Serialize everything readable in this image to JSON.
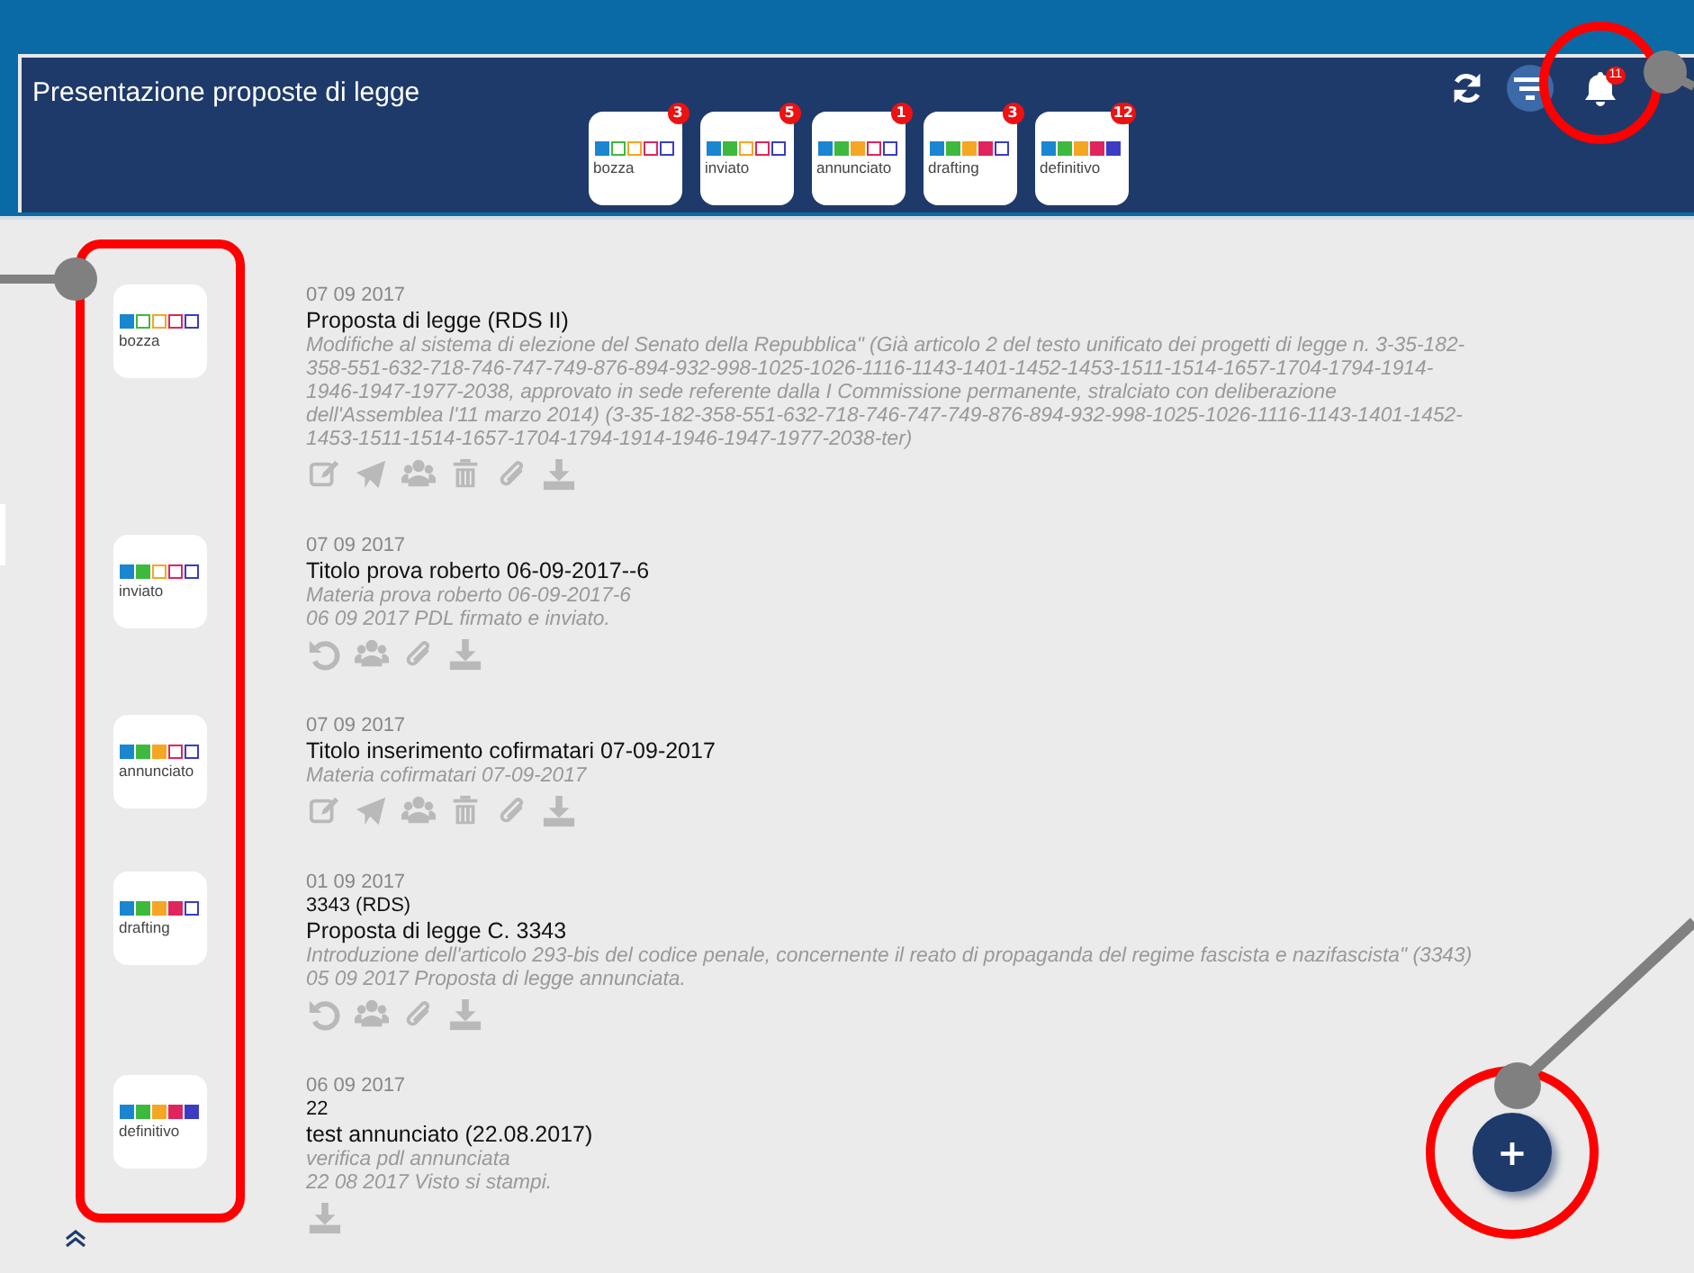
{
  "header": {
    "title": "Presentazione proposte di legge",
    "notifications": {
      "badge": "11",
      "highlighted": true
    }
  },
  "status_tiles": [
    {
      "kind": "bozza",
      "label": "bozza",
      "badge": "3"
    },
    {
      "kind": "inviato",
      "label": "inviato",
      "badge": "5"
    },
    {
      "kind": "annunciato",
      "label": "annunciato",
      "badge": "1"
    },
    {
      "kind": "drafting",
      "label": "drafting",
      "badge": "3"
    },
    {
      "kind": "definitivo",
      "label": "definitivo",
      "badge": "12"
    }
  ],
  "status_column_highlighted": true,
  "proposals": [
    {
      "status": {
        "kind": "bozza",
        "label": "bozza"
      },
      "date": "07 09 2017",
      "title": "Proposta di legge (RDS II)",
      "notes": [
        "Modifiche al sistema di elezione del Senato della Repubblica\" (Già articolo 2 del testo unificato dei progetti di legge n. 3-35-182-358-551-632-718-746-747-749-876-894-932-998-1025-1026-1116-1143-1401-1452-1453-1511-1514-1657-1704-1794-1914-1946-1947-1977-2038, approvato in sede referente dalla I Commissione permanente, stralciato con deliberazione dell'Assemblea l'11 marzo 2014) (3-35-182-358-551-632-718-746-747-749-876-894-932-998-1025-1026-1116-1143-1401-1452-1453-1511-1514-1657-1704-1794-1914-1946-1947-1977-2038-ter)"
      ],
      "actions": [
        {
          "kind": "edit"
        },
        {
          "kind": "send"
        },
        {
          "kind": "group"
        },
        {
          "kind": "trash"
        },
        {
          "kind": "clip"
        },
        {
          "kind": "download"
        }
      ]
    },
    {
      "status": {
        "kind": "inviato",
        "label": "inviato"
      },
      "date": "07 09 2017",
      "title": "Titolo prova roberto 06-09-2017--6",
      "notes": [
        "Materia prova roberto 06-09-2017-6",
        "06 09 2017 PDL firmato e inviato."
      ],
      "actions": [
        {
          "kind": "undo"
        },
        {
          "kind": "group"
        },
        {
          "kind": "clip"
        },
        {
          "kind": "download"
        }
      ]
    },
    {
      "status": {
        "kind": "annunciato",
        "label": "annunciato"
      },
      "date": "07 09 2017",
      "title": "Titolo inserimento cofirmatari 07-09-2017",
      "notes": [
        "Materia cofirmatari 07-09-2017"
      ],
      "actions": [
        {
          "kind": "edit"
        },
        {
          "kind": "send"
        },
        {
          "kind": "group"
        },
        {
          "kind": "trash"
        },
        {
          "kind": "clip"
        },
        {
          "kind": "download"
        }
      ]
    },
    {
      "status": {
        "kind": "drafting",
        "label": "drafting"
      },
      "date": "01 09 2017",
      "number": "3343 (RDS)",
      "title": "Proposta di legge C. 3343",
      "notes": [
        "Introduzione dell'articolo 293-bis del codice penale, concernente il reato di propaganda del regime fascista e nazifascista\" (3343)",
        "05 09 2017 Proposta di legge annunciata."
      ],
      "actions": [
        {
          "kind": "undo"
        },
        {
          "kind": "group"
        },
        {
          "kind": "clip"
        },
        {
          "kind": "download"
        }
      ]
    },
    {
      "status": {
        "kind": "definitivo",
        "label": "definitivo"
      },
      "date": "06 09 2017",
      "number": "22",
      "title": "test annunciato (22.08.2017)",
      "notes": [
        "verifica pdl annunciata",
        "22 08 2017 Visto si stampi."
      ],
      "actions": [
        {
          "kind": "download"
        }
      ]
    }
  ],
  "add_button": {
    "label": "+",
    "highlighted": true
  }
}
